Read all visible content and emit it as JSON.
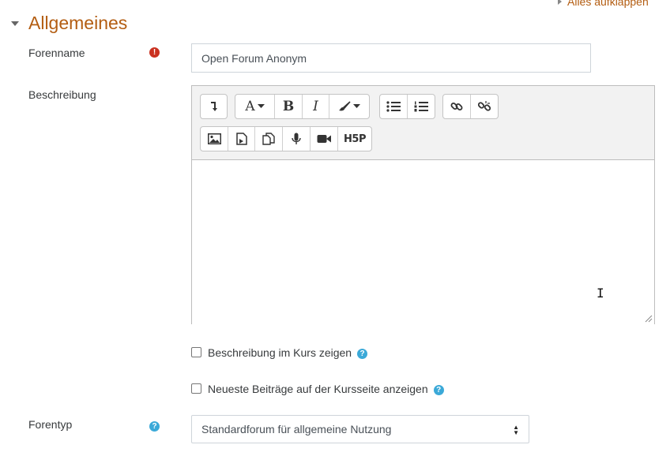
{
  "header": {
    "expand_all": "Alles aufklappen"
  },
  "section": {
    "title": "Allgemeines"
  },
  "form": {
    "forum_name": {
      "label": "Forenname",
      "value": "Open Forum Anonym"
    },
    "description": {
      "label": "Beschreibung"
    },
    "show_description": {
      "label": "Beschreibung im Kurs zeigen",
      "checked": false
    },
    "show_latest_posts": {
      "label": "Neueste Beiträge auf der Kursseite anzeigen",
      "checked": false
    },
    "forum_type": {
      "label": "Forentyp",
      "selected": "Standardforum für allgemeine Nutzung"
    }
  },
  "toolbar": {
    "buttons": [
      "collapse-icon",
      "font-icon",
      "bold-icon",
      "italic-icon",
      "brush-icon",
      "unordered-list-icon",
      "ordered-list-icon",
      "link-icon",
      "unlink-icon",
      "image-icon",
      "media-icon",
      "manage-files-icon",
      "record-audio-icon",
      "record-video-icon",
      "h5p-icon"
    ],
    "bold_glyph": "B",
    "italic_glyph": "I",
    "font_glyph": "A",
    "h5p_label": "H5P"
  },
  "colors": {
    "accent": "#b35d12",
    "required": "#ca3120",
    "help": "#3ba9d8"
  }
}
